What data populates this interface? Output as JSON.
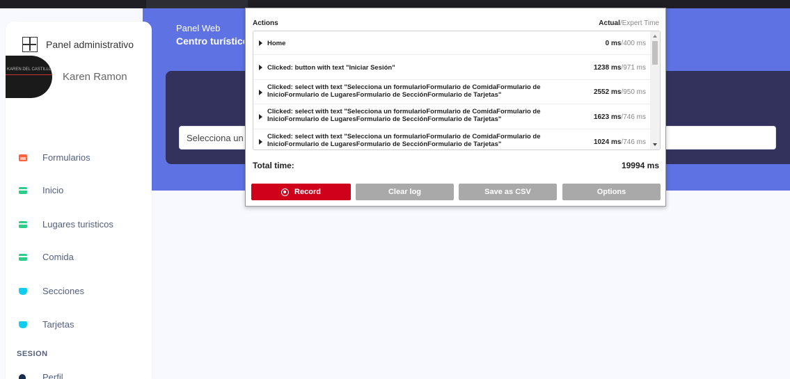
{
  "header": {
    "crumb": "Panel Web",
    "title": "Centro turístico"
  },
  "form": {
    "select_value": "Selecciona un formulario"
  },
  "sidebar": {
    "brand": "Panel administrativo",
    "user_name": "Karen Ramon",
    "avatar_text": "KAREN DEL CASTILLO",
    "items": [
      {
        "label": "Formularios",
        "icon": "calendar-icon"
      },
      {
        "label": "Inicio",
        "icon": "card-icon"
      },
      {
        "label": "Lugares turisticos",
        "icon": "card-icon"
      },
      {
        "label": "Comida",
        "icon": "card-icon"
      },
      {
        "label": "Secciones",
        "icon": "cube-icon"
      },
      {
        "label": "Tarjetas",
        "icon": "cube-icon"
      }
    ],
    "section_label": "SESION",
    "partial_item": "Perfil"
  },
  "panel": {
    "actions_header": "Actions",
    "time_header_actual": "Actual",
    "time_header_expert": "/Expert Time",
    "rows": [
      {
        "label": "Home",
        "actual": "0",
        "expert": "/400 ms"
      },
      {
        "label": "Clicked: button with text \"Iniciar Sesión\"",
        "actual": "1238",
        "expert": "/971 ms"
      },
      {
        "label": "Clicked: select with text \"Selecciona un formularioFormulario de ComidaFormulario de InicioFormulario de LugaresFormulario de SecciónFormulario de Tarjetas\"",
        "actual": "2552",
        "expert": "/950 ms"
      },
      {
        "label": "Clicked: select with text \"Selecciona un formularioFormulario de ComidaFormulario de InicioFormulario de LugaresFormulario de SecciónFormulario de Tarjetas\"",
        "actual": "1623",
        "expert": "/746 ms"
      },
      {
        "label": "Clicked: select with text \"Selecciona un formularioFormulario de ComidaFormulario de InicioFormulario de LugaresFormulario de SecciónFormulario de Tarjetas\"",
        "actual": "1024",
        "expert": "/746 ms"
      }
    ],
    "ms_unit": " ms",
    "total_label": "Total time:",
    "total_value": "19994 ms",
    "buttons": {
      "record": "Record",
      "clear": "Clear log",
      "csv": "Save as CSV",
      "options": "Options"
    }
  },
  "colors": {
    "header_blue": "#5e72e4",
    "card_dark": "#32325d",
    "record_red": "#d0021b",
    "button_gray": "#a9a9a9"
  }
}
